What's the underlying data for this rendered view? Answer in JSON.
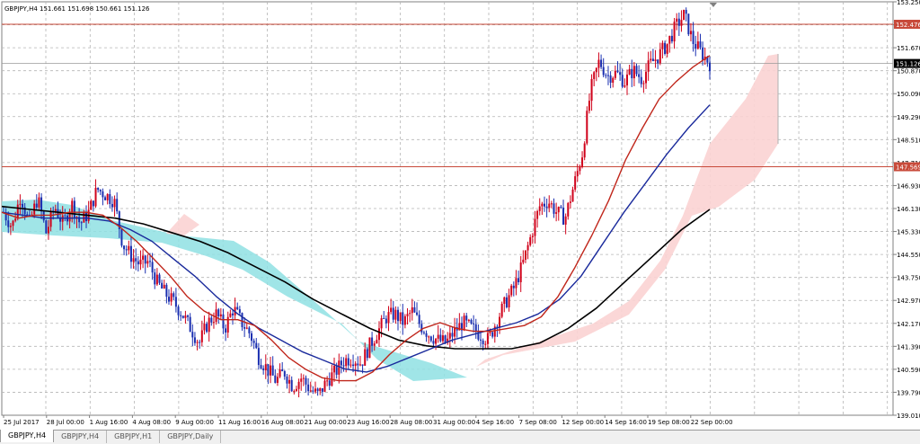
{
  "header": {
    "symbol_line": "GBPJPY,H4  151.661 151.698 150.661 151.126"
  },
  "tabs": [
    {
      "label": "GBPJPY,H4",
      "active": true
    },
    {
      "label": "GBPJPY,H4",
      "active": false
    },
    {
      "label": "GBPJPY,H1",
      "active": false
    },
    {
      "label": "GBPJPY,Daily",
      "active": false
    }
  ],
  "colors": {
    "bull_candle": "#d0021b",
    "bear_candle": "#1a2fb0",
    "ma_fast": "#c0261b",
    "ma_mid": "#1a2a9c",
    "ma_slow": "#000000",
    "cloud_bear": "#8fe0e3",
    "cloud_bull": "#fbd3d3",
    "level_line": "#c84a3a",
    "grid": "#b5b5b5"
  },
  "chart_data": {
    "type": "candlestick",
    "ylim": [
      139.01,
      153.25
    ],
    "y_ticks": [
      "153.250",
      "152.460",
      "151.670",
      "150.870",
      "150.090",
      "149.290",
      "148.510",
      "147.710",
      "146.930",
      "146.130",
      "145.330",
      "144.550",
      "143.750",
      "142.970",
      "142.170",
      "141.390",
      "140.590",
      "139.790",
      "139.010"
    ],
    "x_ticks": [
      "25 Jul 2017",
      "28 Jul 00:00",
      "1 Aug 16:00",
      "4 Aug 08:00",
      "9 Aug 00:00",
      "11 Aug 16:00",
      "16 Aug 08:00",
      "21 Aug 00:00",
      "23 Aug 16:00",
      "28 Aug 08:00",
      "31 Aug 00:00",
      "4 Sep 16:00",
      "7 Sep 08:00",
      "12 Sep 00:00",
      "14 Sep 16:00",
      "19 Sep 08:00",
      "22 Sep 00:00"
    ],
    "horizontal_levels": [
      {
        "value": 152.476,
        "label": "152.476",
        "color": "#c84a3a"
      },
      {
        "value": 147.569,
        "label": "147.569",
        "color": "#c84a3a"
      }
    ],
    "current_price": {
      "value": 151.126,
      "label": "151.126"
    },
    "price_path": [
      146.0,
      145.5,
      146.6,
      145.6,
      146.5,
      145.3,
      146.2,
      145.6,
      146.3,
      145.6,
      146.0,
      146.8,
      146.6,
      146.4,
      144.9,
      144.5,
      144.2,
      144.3,
      143.6,
      143.2,
      142.9,
      142.5,
      142.0,
      141.5,
      142.2,
      142.5,
      142.0,
      142.7,
      142.2,
      141.8,
      141.0,
      140.6,
      140.2,
      140.5,
      140.0,
      140.3,
      139.9,
      139.7,
      140.2,
      140.5,
      140.9,
      141.0,
      140.8,
      141.4,
      141.9,
      142.4,
      142.5,
      142.2,
      142.6,
      142.1,
      141.8,
      141.6,
      141.5,
      141.9,
      142.2,
      142.0,
      141.8,
      141.6,
      142.3,
      142.9,
      143.4,
      144.2,
      145.2,
      146.2,
      146.4,
      146.0,
      145.8,
      146.9,
      148.0,
      150.2,
      151.2,
      150.7,
      150.8,
      150.5,
      150.9,
      150.6,
      151.1,
      151.4,
      151.8,
      152.4,
      152.8,
      151.9,
      151.5,
      151.126
    ],
    "ma_fast": [
      146.0,
      145.8,
      145.9,
      145.9,
      146.0,
      146.0,
      145.9,
      145.5,
      145.0,
      144.4,
      143.8,
      143.1,
      142.6,
      142.3,
      142.3,
      142.1,
      141.6,
      141.0,
      140.6,
      140.3,
      140.2,
      140.2,
      140.5,
      141.1,
      141.6,
      142.0,
      142.2,
      142.0,
      141.9,
      141.9,
      142.0,
      142.1,
      142.4,
      143.1,
      144.1,
      145.2,
      146.4,
      147.8,
      148.9,
      149.9,
      150.5,
      151.0,
      151.4
    ],
    "ma_mid": [
      146.0,
      145.9,
      145.8,
      145.8,
      145.8,
      145.7,
      145.4,
      145.0,
      144.4,
      143.8,
      143.1,
      142.5,
      142.0,
      141.6,
      141.2,
      140.9,
      140.6,
      140.5,
      140.7,
      141.0,
      141.3,
      141.6,
      141.8,
      142.0,
      142.2,
      142.5,
      143.0,
      143.8,
      144.9,
      146.0,
      147.0,
      148.0,
      148.9,
      149.7
    ],
    "ma_slow": [
      146.2,
      146.1,
      146.0,
      145.9,
      145.8,
      145.6,
      145.3,
      145.0,
      144.6,
      144.1,
      143.6,
      143.0,
      142.5,
      142.0,
      141.6,
      141.4,
      141.3,
      141.3,
      141.3,
      141.5,
      142.0,
      142.7,
      143.6,
      144.5,
      145.4,
      146.1
    ]
  }
}
